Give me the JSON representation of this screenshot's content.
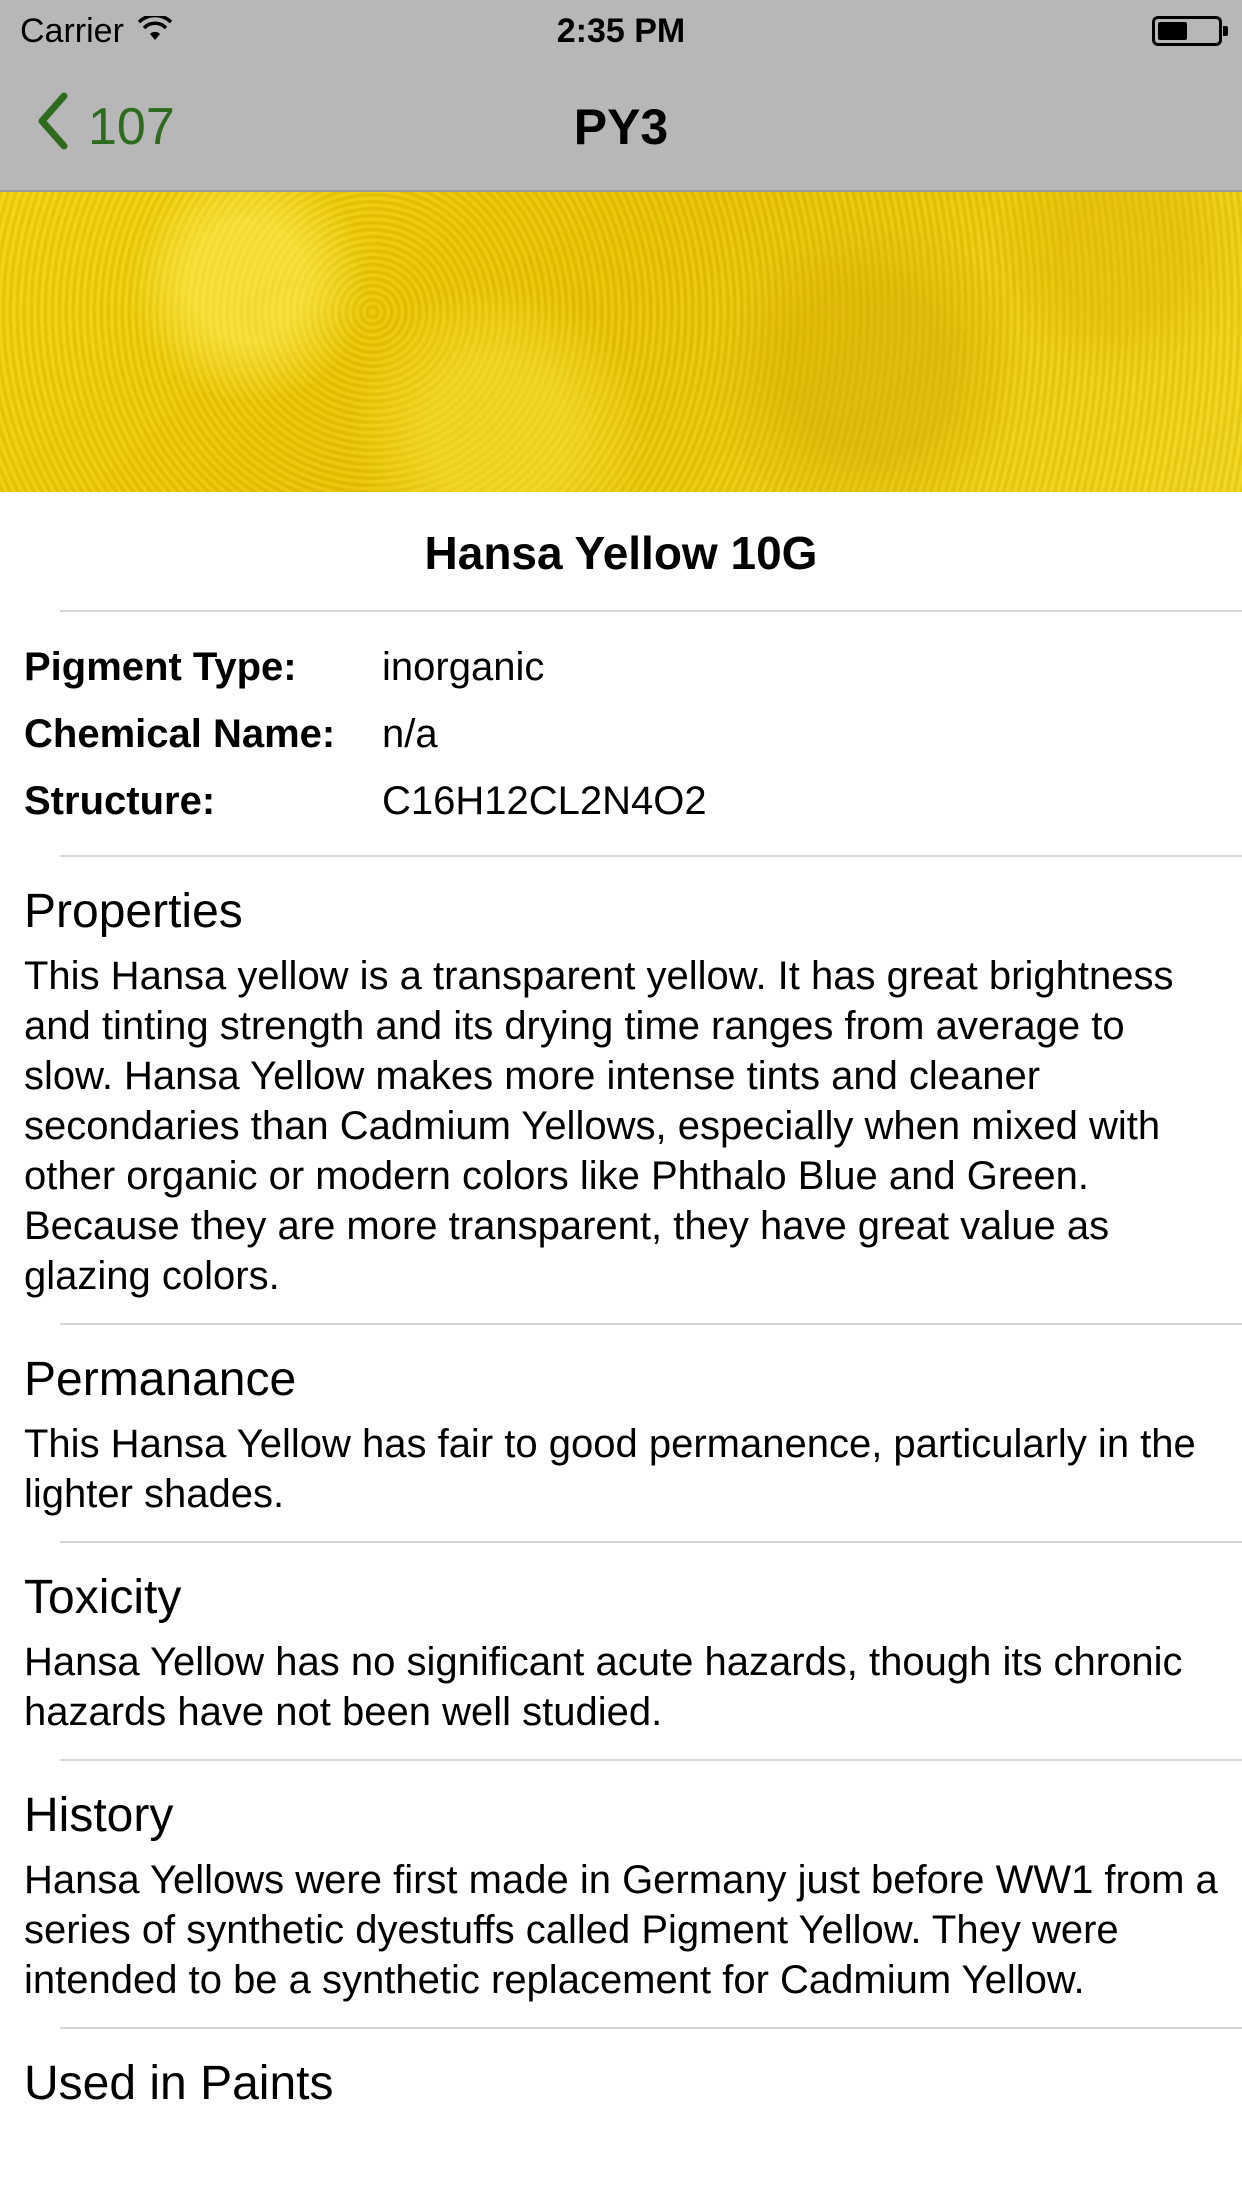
{
  "status_bar": {
    "carrier": "Carrier",
    "time": "2:35 PM",
    "battery_level": 0.5
  },
  "nav": {
    "back_label": "107",
    "title": "PY3",
    "accent_color": "#2e6b1f"
  },
  "pigment": {
    "name": "Hansa Yellow 10G",
    "specs": [
      {
        "label": "Pigment Type:",
        "value": "inorganic"
      },
      {
        "label": "Chemical Name:",
        "value": "n/a"
      },
      {
        "label": "Structure:",
        "value": "C16H12CL2N4O2"
      }
    ],
    "sections": [
      {
        "title": "Properties",
        "body": "This Hansa yellow is a transparent yellow. It has great brightness and tinting strength and its drying time ranges from average to slow. Hansa Yellow makes more intense tints and cleaner secondaries than Cadmium Yellows, especially when mixed with other organic or modern colors like Phthalo Blue and Green. Because they are more transparent, they have great value as glazing colors."
      },
      {
        "title": "Permanance",
        "body": "This Hansa Yellow has fair to good permanence, particularly in the lighter shades."
      },
      {
        "title": "Toxicity",
        "body": "Hansa Yellow has no significant acute hazards, though its chronic hazards have not been well studied."
      },
      {
        "title": "History",
        "body": "Hansa Yellows were first made in Germany just before WW1 from a series of synthetic dyestuffs called Pigment Yellow. They were intended to be a synthetic replacement for Cadmium Yellow."
      },
      {
        "title": "Used in Paints",
        "body": ""
      }
    ]
  }
}
